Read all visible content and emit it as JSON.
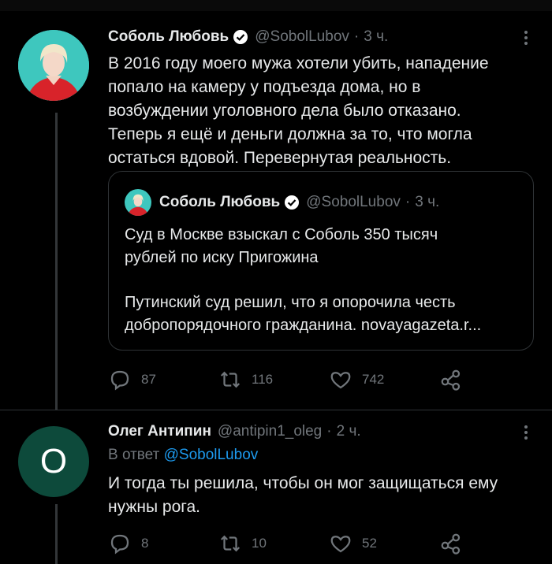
{
  "tweet1": {
    "author_name": "Соболь Любовь",
    "handle": "@SobolLubov",
    "time": "3 ч.",
    "text_lines": [
      "В 2016 году моего мужа хотели убить, нападение",
      "попало на камеру у подъезда дома, но в",
      "возбуждении уголовного дела было отказано.",
      "Теперь я ещё и деньги должна за то, что могла",
      "остаться вдовой. Перевернутая реальность."
    ],
    "quote": {
      "author_name": "Соболь Любовь",
      "handle": "@SobolLubov",
      "time": "3 ч.",
      "line1": "Суд в Москве взыскал с Соболь 350 тысяч",
      "line2": "рублей по иску Пригожина",
      "line3": "Путинский суд решил, что я опорочила честь",
      "line4": "добропорядочного гражданина.  novayagazeta.r..."
    },
    "actions": {
      "replies": "87",
      "retweets": "116",
      "likes": "742"
    }
  },
  "tweet2": {
    "author_name": "Олег Антипин",
    "handle": "@antipin1_oleg",
    "time": "2 ч.",
    "avatar_letter": "O",
    "reply_prefix": "В ответ",
    "reply_handle": "@SobolLubov",
    "text_lines": [
      "И тогда ты решила, чтобы он мог защищаться ему",
      "нужны рога."
    ],
    "actions": {
      "replies": "8",
      "retweets": "10",
      "likes": "52"
    }
  },
  "colors": {
    "background": "#000000",
    "text": "#e7e9ea",
    "muted": "#71767b",
    "link": "#1d9bf0",
    "verified": "#ffffff"
  },
  "icons": [
    "verified-badge-icon",
    "more-icon",
    "reply-icon",
    "retweet-icon",
    "like-icon",
    "share-icon"
  ]
}
